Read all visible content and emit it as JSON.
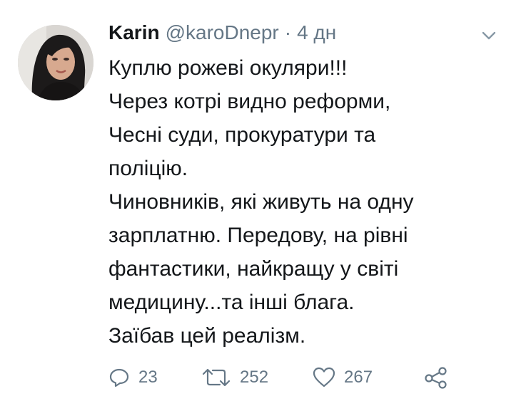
{
  "tweet": {
    "author": {
      "name": "Karin",
      "handle": "@karoDnepr",
      "avatar": "avatar-photo"
    },
    "separator": "·",
    "time": "4 дн",
    "menu_icon": "chevron-down-icon",
    "text_lines": [
      "Куплю рожеві окуляри!!!",
      "Через котрі видно реформи,",
      "Чесні суди, прокуратури та",
      "поліцію.",
      "Чиновників, які живуть на одну",
      "зарплатню. Передову, на рівні",
      "фантастики, найкращу у світі",
      "медицину...та інші блага.",
      "Заїбав цей реалізм."
    ],
    "actions": {
      "reply": {
        "icon": "reply-icon",
        "count": "23"
      },
      "retweet": {
        "icon": "retweet-icon",
        "count": "252"
      },
      "like": {
        "icon": "heart-icon",
        "count": "267"
      },
      "share": {
        "icon": "share-icon"
      }
    },
    "colors": {
      "text": "#14171a",
      "secondary": "#657786",
      "background": "#ffffff"
    }
  }
}
